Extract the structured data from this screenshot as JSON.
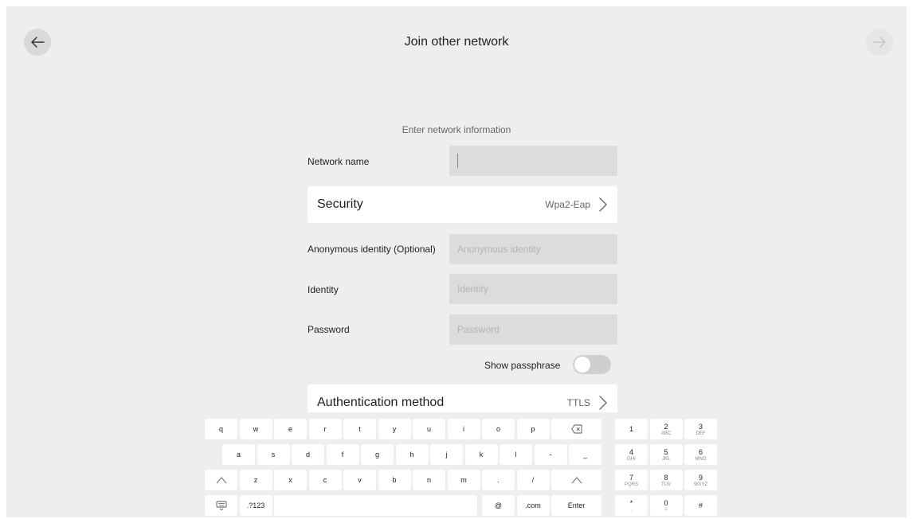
{
  "header": {
    "title": "Join other network",
    "back_icon": "arrow-left-icon",
    "next_icon": "arrow-right-icon"
  },
  "form": {
    "subtitle": "Enter network information",
    "network_name": {
      "label": "Network name",
      "value": ""
    },
    "security": {
      "label": "Security",
      "value": "Wpa2-Eap"
    },
    "anonymous_identity": {
      "label": "Anonymous identity (Optional)",
      "placeholder": "Anonymous identity"
    },
    "identity": {
      "label": "Identity",
      "placeholder": "Identity"
    },
    "password": {
      "label": "Password",
      "placeholder": "Password"
    },
    "show_passphrase": {
      "label": "Show passphrase",
      "on": false
    },
    "auth_method": {
      "label": "Authentication method",
      "value": "TTLS"
    }
  },
  "keyboard": {
    "row1": [
      "q",
      "w",
      "e",
      "r",
      "t",
      "y",
      "u",
      "i",
      "o",
      "p"
    ],
    "row2": [
      "a",
      "s",
      "d",
      "f",
      "g",
      "h",
      "j",
      "k",
      "l",
      "-",
      "_"
    ],
    "row3": [
      "z",
      "x",
      "c",
      "v",
      "b",
      "n",
      "m",
      ".",
      "/"
    ],
    "row4": {
      "numbers": ".?123",
      "at": "@",
      "com": ".com",
      "enter": "Enter"
    },
    "numpad": [
      [
        {
          "main": "1",
          "sub": ""
        },
        {
          "main": "2",
          "sub": "ABC"
        },
        {
          "main": "3",
          "sub": "DEF"
        }
      ],
      [
        {
          "main": "4",
          "sub": "GHI"
        },
        {
          "main": "5",
          "sub": "JKL"
        },
        {
          "main": "6",
          "sub": "MNO"
        }
      ],
      [
        {
          "main": "7",
          "sub": "PQRS"
        },
        {
          "main": "8",
          "sub": "TUV"
        },
        {
          "main": "9",
          "sub": "WXYZ"
        }
      ],
      [
        {
          "main": "*",
          "sub": "."
        },
        {
          "main": "0",
          "sub": "+"
        },
        {
          "main": "#",
          "sub": ""
        }
      ]
    ],
    "icons": {
      "backspace": "backspace-icon",
      "shift": "shift-icon",
      "hide_keyboard": "keyboard-hide-icon"
    }
  }
}
